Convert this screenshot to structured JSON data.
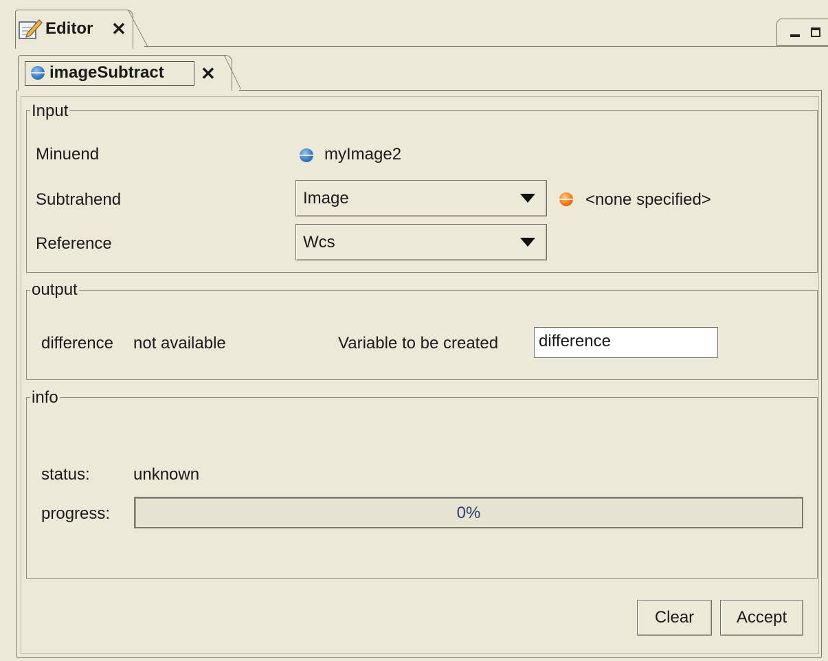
{
  "editor_tab": {
    "label": "Editor"
  },
  "inner_tab": {
    "label": "imageSubtract"
  },
  "input_group": {
    "legend": "Input",
    "minuend": {
      "label": "Minuend",
      "value": "myImage2"
    },
    "subtrahend": {
      "label": "Subtrahend",
      "selected": "Image",
      "status": "<none specified>"
    },
    "reference": {
      "label": "Reference",
      "selected": "Wcs"
    }
  },
  "output_group": {
    "legend": "output",
    "difference_label": "difference",
    "difference_value": "not available",
    "variable_label": "Variable to be created",
    "variable_value": "difference"
  },
  "info_group": {
    "legend": "info",
    "status_label": "status:",
    "status_value": "unknown",
    "progress_label": "progress:",
    "progress_text": "0%",
    "progress_fraction": 0
  },
  "buttons": {
    "clear": "Clear",
    "accept": "Accept"
  },
  "icons": {
    "editor": "editor-pencil-icon",
    "variable_blue": "blue-ball-icon",
    "variable_orange": "orange-ball-icon"
  },
  "colors": {
    "background": "#ece9d8",
    "blue_ball": "#3c7bc6",
    "orange_ball": "#f07a1a"
  }
}
